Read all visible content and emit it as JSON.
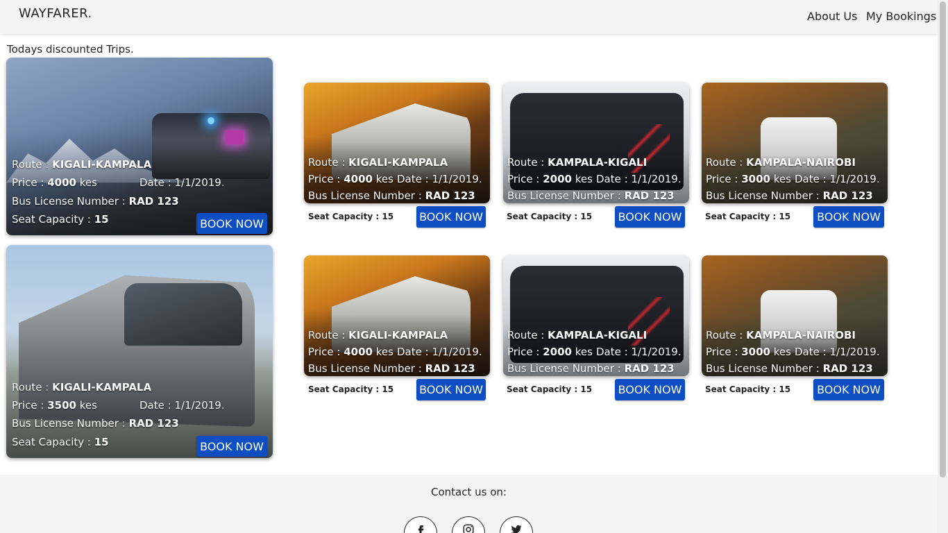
{
  "header": {
    "brand": "WAYFARER.",
    "nav": [
      "About Us",
      "My Bookings"
    ]
  },
  "section_title": "Todays discounted Trips.",
  "labels": {
    "route": "Route :",
    "price": "Price :",
    "currency": "kes",
    "date": "Date :",
    "license": "Bus License Number :",
    "seat": "Seat Capacity :",
    "book": "BOOK NOW"
  },
  "featured_trips": [
    {
      "route": "KIGALI-KAMPALA",
      "price": "4000",
      "date": "1/1/2019.",
      "license": "RAD 123",
      "seats": "15"
    },
    {
      "route": "KIGALI-KAMPALA",
      "price": "3500",
      "date": "1/1/2019.",
      "license": "RAD 123",
      "seats": "15"
    }
  ],
  "trips": [
    {
      "route": "KIGALI-KAMPALA",
      "price": "4000",
      "date": "1/1/2019.",
      "license": "RAD 123",
      "seats": "15"
    },
    {
      "route": "KAMPALA-KIGALI",
      "price": "2000",
      "date": "1/1/2019.",
      "license": "RAD 123",
      "seats": "15"
    },
    {
      "route": "KAMPALA-NAIROBI",
      "price": "3000",
      "date": "1/1/2019.",
      "license": "RAD 123",
      "seats": "15"
    },
    {
      "route": "KIGALI-KAMPALA",
      "price": "4000",
      "date": "1/1/2019.",
      "license": "RAD 123",
      "seats": "15"
    },
    {
      "route": "KAMPALA-KIGALI",
      "price": "2000",
      "date": "1/1/2019.",
      "license": "RAD 123",
      "seats": "15"
    },
    {
      "route": "KAMPALA-NAIROBI",
      "price": "3000",
      "date": "1/1/2019.",
      "license": "RAD 123",
      "seats": "15"
    }
  ],
  "footer": {
    "contact": "Contact us on:",
    "social_icons": [
      "facebook-icon",
      "instagram-icon",
      "twitter-icon"
    ]
  },
  "colors": {
    "accent": "#0d4fc2",
    "navbar": "#f4f4f4"
  }
}
